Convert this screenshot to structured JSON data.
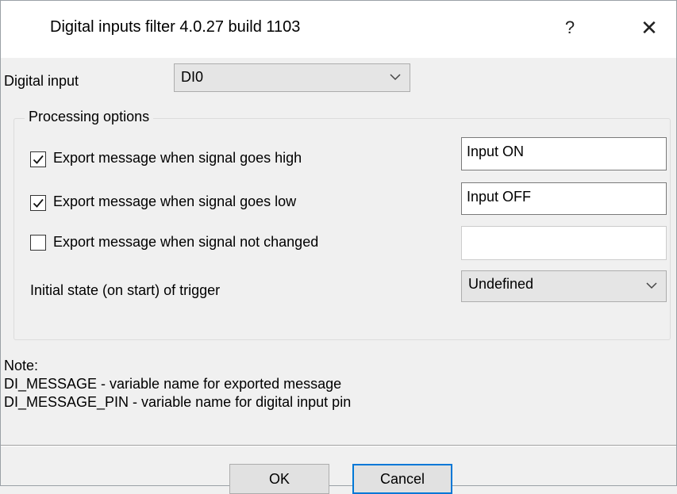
{
  "window": {
    "title": "Digital inputs filter 4.0.27 build 1103",
    "help_label": "?",
    "close_label": "✕"
  },
  "digital_input": {
    "label": "Digital input",
    "selected": "DI0"
  },
  "processing": {
    "caption": "Processing options",
    "rows": [
      {
        "label": "Export message when signal goes high",
        "checked": true,
        "value": "Input ON"
      },
      {
        "label": "Export message when signal goes low",
        "checked": true,
        "value": "Input OFF"
      },
      {
        "label": "Export message when signal not changed",
        "checked": false,
        "value": ""
      }
    ],
    "initial_state": {
      "label": "Initial state (on start) of trigger",
      "selected": "Undefined"
    }
  },
  "note": {
    "heading": "Note:",
    "line1": "DI_MESSAGE - variable name for exported message",
    "line2": "DI_MESSAGE_PIN - variable name for digital input pin"
  },
  "buttons": {
    "ok": "OK",
    "cancel": "Cancel"
  }
}
